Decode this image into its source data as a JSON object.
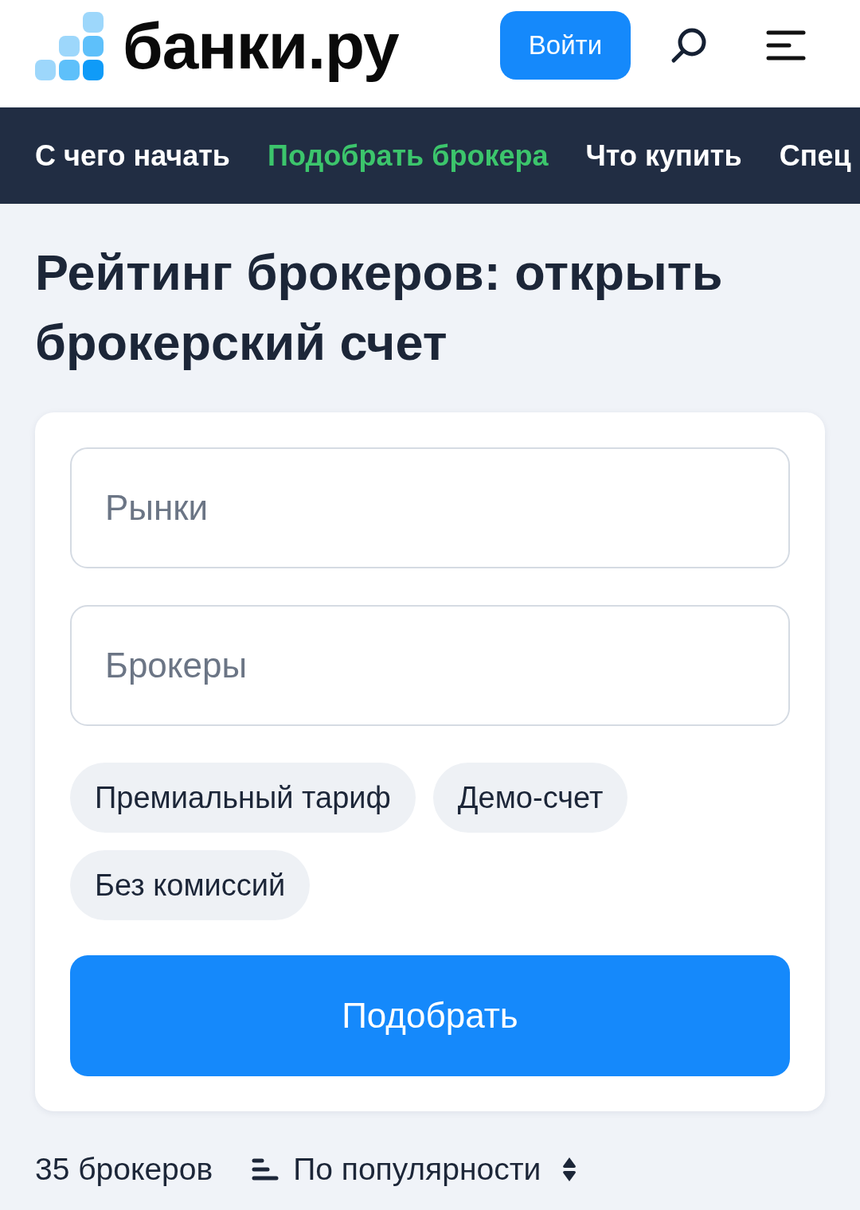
{
  "header": {
    "logo": "банки.ру",
    "login_button": "Войти"
  },
  "nav": {
    "items": [
      {
        "label": "С чего начать",
        "selected": false
      },
      {
        "label": "Подобрать брокера",
        "selected": true
      },
      {
        "label": "Что купить",
        "selected": false
      },
      {
        "label": "Спец",
        "selected": false
      }
    ]
  },
  "title": "Рейтинг брокеров: открыть брокерский счет",
  "filters": {
    "fields": [
      {
        "placeholder": "Рынки"
      },
      {
        "placeholder": "Брокеры"
      }
    ],
    "chips": [
      {
        "label": "Премиальный тариф",
        "selected": false
      },
      {
        "label": "Демо-счет",
        "selected": false
      },
      {
        "label": "Без комиссий",
        "selected": false
      }
    ],
    "submit_button": "Подобрать"
  },
  "results": {
    "count": "35 брокеров",
    "sort": "По популярности"
  }
}
